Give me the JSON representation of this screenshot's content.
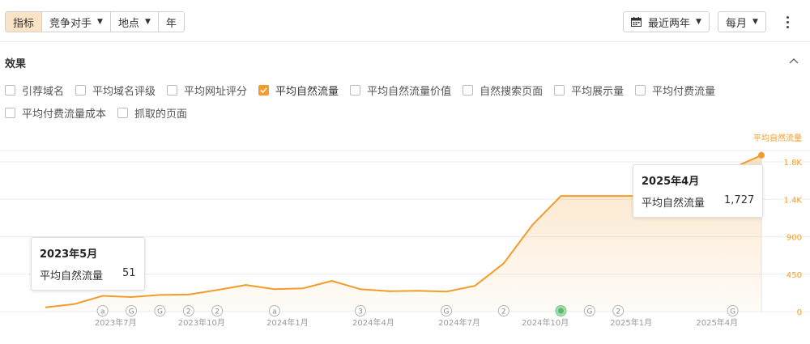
{
  "toolbar": {
    "tabs": [
      {
        "label": "指标",
        "active": true,
        "dropdown": false
      },
      {
        "label": "竞争对手",
        "active": false,
        "dropdown": true
      },
      {
        "label": "地点",
        "active": false,
        "dropdown": true
      },
      {
        "label": "年",
        "active": false,
        "dropdown": false
      }
    ],
    "range_label": "最近两年",
    "interval_label": "每月",
    "more_icon": "more-vertical-icon",
    "calendar_icon": "calendar-icon",
    "caret_icon": "caret-down-icon"
  },
  "section": {
    "title": "效果",
    "collapse_icon": "chevron-up-icon"
  },
  "metrics": {
    "row1": [
      {
        "label": "引荐域名",
        "checked": false
      },
      {
        "label": "平均域名评级",
        "checked": false
      },
      {
        "label": "平均网址评分",
        "checked": false
      },
      {
        "label": "平均自然流量",
        "checked": true
      },
      {
        "label": "平均自然流量价值",
        "checked": false
      },
      {
        "label": "自然搜索页面",
        "checked": false
      },
      {
        "label": "平均展示量",
        "checked": false
      },
      {
        "label": "平均付费流量",
        "checked": false
      }
    ],
    "row2": [
      {
        "label": "平均付费流量成本",
        "checked": false
      },
      {
        "label": "抓取的页面",
        "checked": false
      }
    ]
  },
  "colors": {
    "accent": "#f39c2c",
    "active_tab_bg": "#fbe3c6",
    "grid": "#ececec",
    "axis_label": "#999999"
  },
  "chart_data": {
    "type": "area",
    "series": [
      {
        "name": "平均自然流量",
        "values": [
          51,
          90,
          190,
          175,
          200,
          205,
          260,
          320,
          270,
          280,
          370,
          270,
          245,
          250,
          240,
          310,
          580,
          1040,
          1390,
          1390,
          1390,
          1390,
          1390,
          1440,
          1727,
          1880
        ]
      }
    ],
    "y_axis_title": "平均自然流量",
    "ylim": [
      0,
      1800
    ],
    "y_ticks": [
      {
        "value": 0,
        "label": "0"
      },
      {
        "value": 450,
        "label": "450"
      },
      {
        "value": 900,
        "label": "900"
      },
      {
        "value": 1350,
        "label": "1.4K"
      },
      {
        "value": 1800,
        "label": "1.8K"
      }
    ],
    "x_ticks": [
      {
        "index": 2,
        "label": "2023年7月"
      },
      {
        "index": 5,
        "label": "2023年10月"
      },
      {
        "index": 8,
        "label": "2024年1月"
      },
      {
        "index": 11,
        "label": "2024年4月"
      },
      {
        "index": 14,
        "label": "2024年7月"
      },
      {
        "index": 17,
        "label": "2024年10月"
      },
      {
        "index": 20,
        "label": "2025年1月"
      },
      {
        "index": 23,
        "label": "2025年4月"
      }
    ],
    "annotations": [
      {
        "index": 2,
        "label": "a",
        "active": false
      },
      {
        "index": 3,
        "label": "G",
        "active": false
      },
      {
        "index": 4,
        "label": "G",
        "active": false
      },
      {
        "index": 5,
        "label": "2",
        "active": false
      },
      {
        "index": 6,
        "label": "2",
        "active": false
      },
      {
        "index": 8,
        "label": "a",
        "active": false
      },
      {
        "index": 11,
        "label": "3",
        "active": false
      },
      {
        "index": 14,
        "label": "G",
        "active": false
      },
      {
        "index": 16,
        "label": "2",
        "active": false
      },
      {
        "index": 18,
        "label": "",
        "active": true
      },
      {
        "index": 19,
        "label": "G",
        "active": false
      },
      {
        "index": 20,
        "label": "2",
        "active": false
      },
      {
        "index": 24,
        "label": "G",
        "active": false
      }
    ],
    "tooltips": [
      {
        "title": "2023年5月",
        "label": "平均自然流量",
        "value": "51"
      },
      {
        "title": "2025年4月",
        "label": "平均自然流量",
        "value": "1,727"
      }
    ],
    "grid": true,
    "legend": "none"
  }
}
